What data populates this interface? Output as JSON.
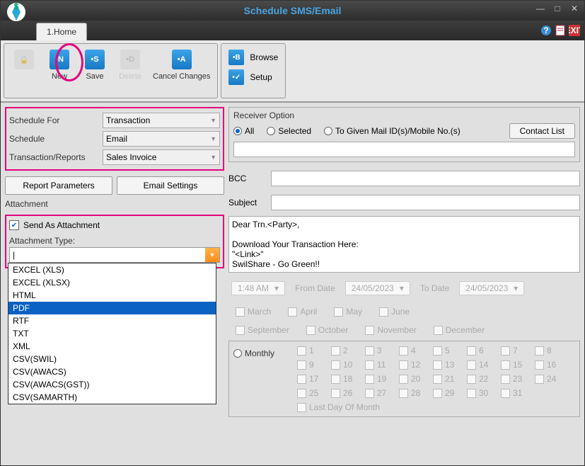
{
  "window": {
    "title": "Schedule SMS/Email"
  },
  "tabs": {
    "home": "1.Home"
  },
  "toolbar": {
    "new": "New",
    "save": "Save",
    "delete": "Delete",
    "cancel": "Cancel Changes",
    "browse": "Browse",
    "setup": "Setup"
  },
  "schedule": {
    "for_label": "Schedule For",
    "for_value": "Transaction",
    "sched_label": "Schedule",
    "sched_value": "Email",
    "trn_label": "Transaction/Reports",
    "trn_value": "Sales Invoice"
  },
  "buttons": {
    "report_params": "Report Parameters",
    "email_settings": "Email Settings"
  },
  "attachment": {
    "header": "Attachment",
    "send_as": "Send As Attachment",
    "type_label": "Attachment Type:",
    "input_value": "|",
    "options": [
      "EXCEL (XLS)",
      "EXCEL (XLSX)",
      "HTML",
      "PDF",
      "RTF",
      "TXT",
      "XML",
      "CSV(SWIL)",
      "CSV(AWACS)",
      "CSV(AWACS(GST))",
      "CSV(SAMARTH)"
    ],
    "selected": "PDF"
  },
  "receiver": {
    "title": "Receiver Option",
    "all": "All",
    "selected": "Selected",
    "given": "To Given Mail ID(s)/Mobile No.(s)",
    "contact": "Contact List",
    "bcc_label": "BCC",
    "subject_label": "Subject",
    "body": "Dear Trn.<Party>,\n\nDownload Your Transaction Here:\n\"<Link>\"\nSwilShare - Go Green!!"
  },
  "time": {
    "time_val": "1:48 AM",
    "from_label": "From Date",
    "from_val": "24/05/2023",
    "to_label": "To Date",
    "to_val": "24/05/2023"
  },
  "months": {
    "row1": [
      "March",
      "April",
      "May",
      "June"
    ],
    "row2": [
      "September",
      "October",
      "November",
      "December"
    ]
  },
  "recurrence": {
    "monthly": "Monthly",
    "days": [
      "1",
      "2",
      "3",
      "4",
      "5",
      "6",
      "7",
      "8",
      "9",
      "10",
      "11",
      "12",
      "13",
      "14",
      "15",
      "16",
      "17",
      "18",
      "19",
      "20",
      "21",
      "22",
      "23",
      "24",
      "25",
      "26",
      "27",
      "28",
      "29",
      "30",
      "31"
    ],
    "lastday": "Last Day Of Month"
  }
}
